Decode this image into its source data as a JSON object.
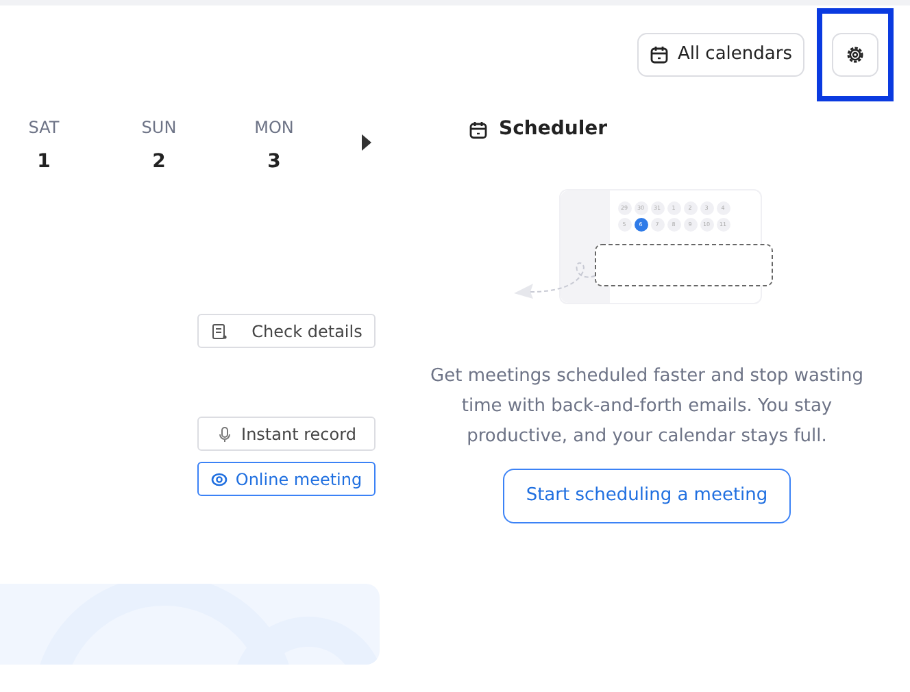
{
  "toolbar": {
    "calendar_filter": "All calendars",
    "settings_highlighted": true
  },
  "days": [
    {
      "weekday": "SAT",
      "date": "1"
    },
    {
      "weekday": "SUN",
      "date": "2"
    },
    {
      "weekday": "MON",
      "date": "3"
    }
  ],
  "actions": [
    {
      "label": "Check details",
      "kind": "details",
      "primary": false
    },
    {
      "label": "Instant record",
      "kind": "record",
      "primary": false
    },
    {
      "label": "Online meeting",
      "kind": "meeting",
      "primary": true
    }
  ],
  "scheduler": {
    "title": "Scheduler",
    "mini_calendar": [
      {
        "day": "29",
        "selected": false
      },
      {
        "day": "30",
        "selected": false
      },
      {
        "day": "31",
        "selected": false
      },
      {
        "day": "1",
        "selected": false
      },
      {
        "day": "2",
        "selected": false
      },
      {
        "day": "3",
        "selected": false
      },
      {
        "day": "4",
        "selected": false
      },
      {
        "day": "5",
        "selected": false
      },
      {
        "day": "6",
        "selected": true
      },
      {
        "day": "7",
        "selected": false
      },
      {
        "day": "8",
        "selected": false
      },
      {
        "day": "9",
        "selected": false
      },
      {
        "day": "10",
        "selected": false
      },
      {
        "day": "11",
        "selected": false
      }
    ],
    "description": "Get meetings scheduled faster and stop wasting time with back-and-forth emails. You stay productive, and your calendar stays full.",
    "cta": "Start scheduling a meeting"
  }
}
